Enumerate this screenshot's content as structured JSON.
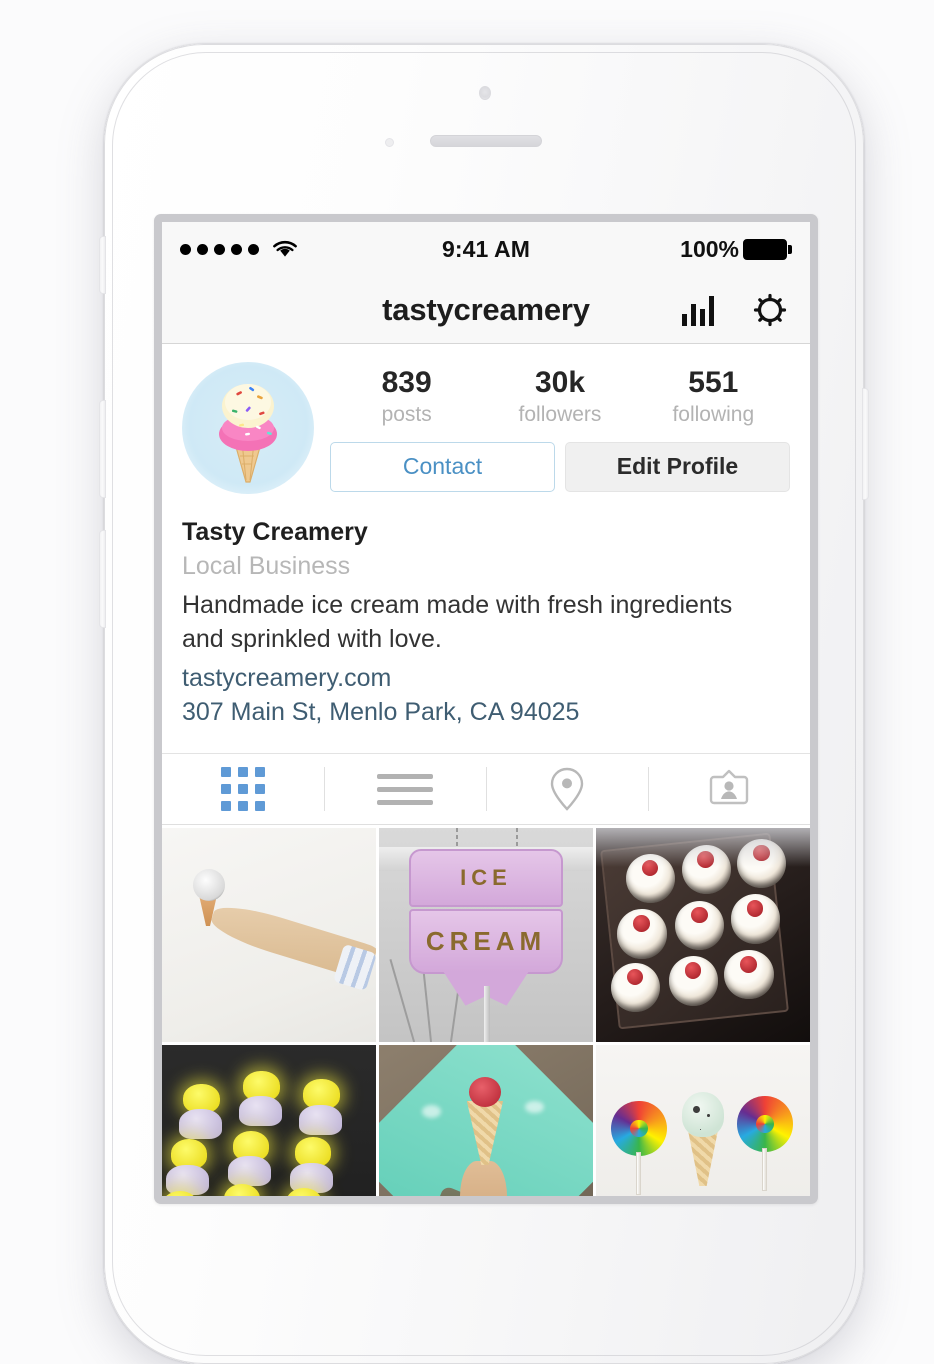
{
  "status_bar": {
    "signal_dots": 5,
    "wifi_icon": "wifi-icon",
    "time": "9:41 AM",
    "battery_percent": "100%",
    "battery_icon": "battery-full-icon"
  },
  "nav_bar": {
    "title": "tastycreamery",
    "insights_icon": "bar-chart-icon",
    "settings_icon": "gear-icon"
  },
  "profile": {
    "avatar_icon": "ice-cream-cone-avatar",
    "stats": [
      {
        "value": "839",
        "label": "posts"
      },
      {
        "value": "30k",
        "label": "followers"
      },
      {
        "value": "551",
        "label": "following"
      }
    ],
    "contact_label": "Contact",
    "edit_profile_label": "Edit Profile",
    "name": "Tasty Creamery",
    "category": "Local Business",
    "description": "Handmade ice cream made with fresh ingredients and sprinkled with love.",
    "website": "tastycreamery.com",
    "address": "307 Main St, Menlo Park, CA  94025"
  },
  "tabs": [
    {
      "name": "grid",
      "icon": "grid-icon",
      "active": true
    },
    {
      "name": "list",
      "icon": "list-icon",
      "active": false
    },
    {
      "name": "map",
      "icon": "map-pin-icon",
      "active": false
    },
    {
      "name": "tagged",
      "icon": "tagged-badge-icon",
      "active": false
    }
  ],
  "photo_grid": [
    {
      "name": "hand-holding-cone"
    },
    {
      "name": "ice-cream-sign",
      "sign_line1": "ICE",
      "sign_line2": "CREAM"
    },
    {
      "name": "chocolate-cherry-cupcakes"
    },
    {
      "name": "yellow-peeps-cupcakes"
    },
    {
      "name": "cone-on-teal-background"
    },
    {
      "name": "rainbow-lollipops-and-mint-cone"
    }
  ],
  "colors": {
    "accent_blue": "#5f9ad6",
    "link_blue": "#3f5d72",
    "contact_blue": "#4a90c4",
    "muted_gray": "#b3b3b3"
  }
}
